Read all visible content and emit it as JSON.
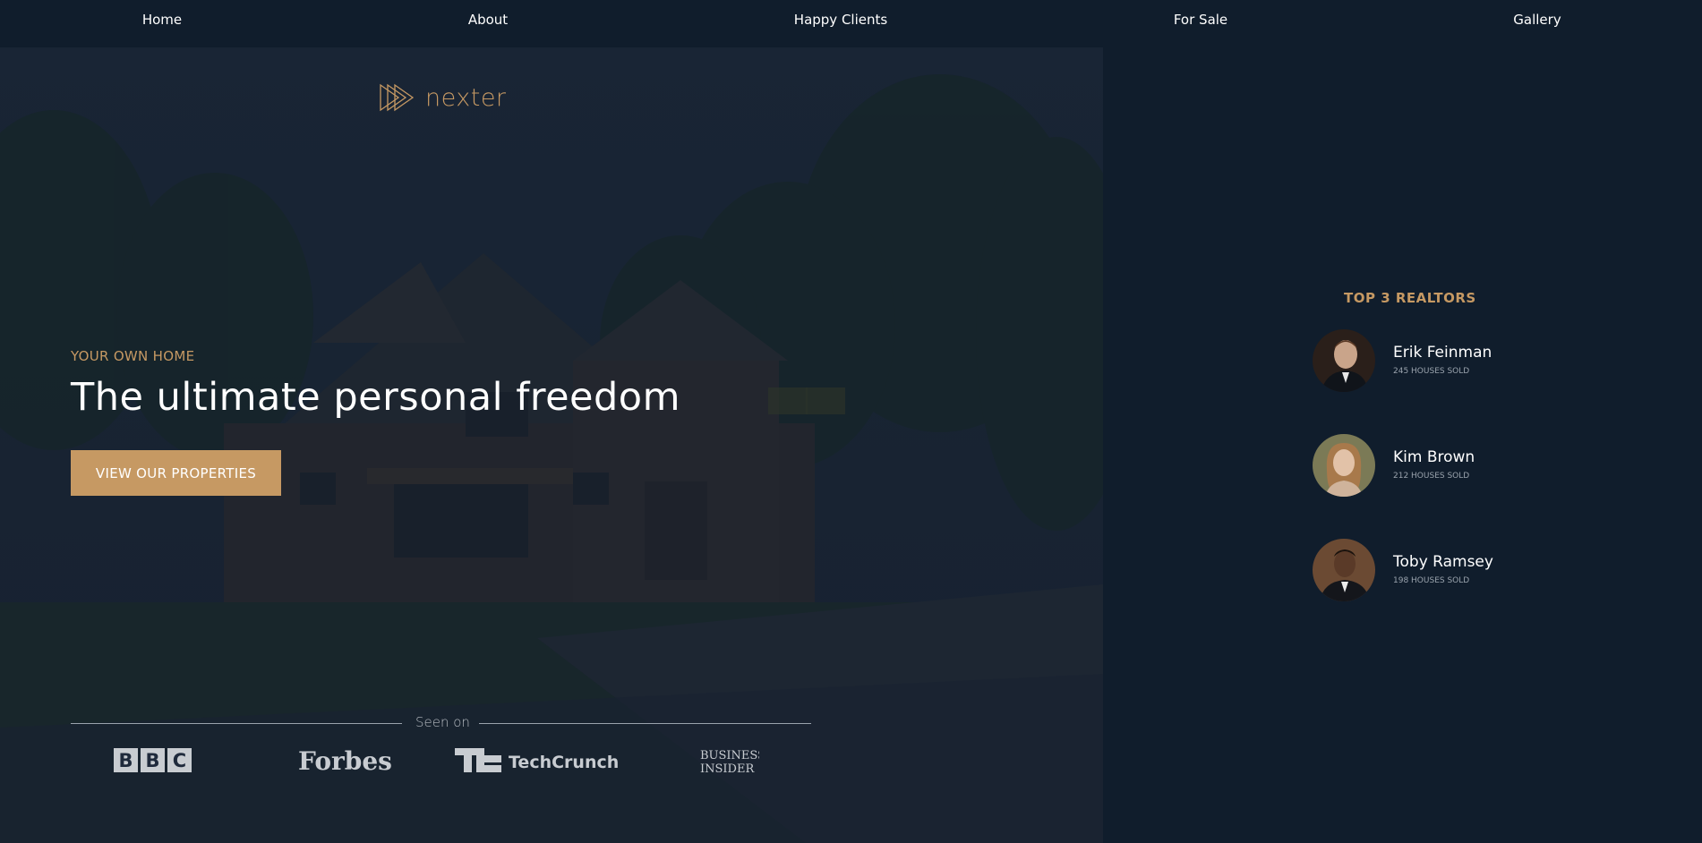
{
  "nav": {
    "items": [
      {
        "label": "Home"
      },
      {
        "label": "About"
      },
      {
        "label": "Happy Clients"
      },
      {
        "label": "For Sale"
      },
      {
        "label": "Gallery"
      }
    ]
  },
  "brand": {
    "name": "nexter",
    "accent_color": "#c69963",
    "background_color": "#101d2c"
  },
  "hero": {
    "eyebrow": "YOUR OWN HOME",
    "headline": "The ultimate personal freedom",
    "cta_label": "VIEW OUR PROPERTIES",
    "seen_on_label": "Seen on",
    "press": [
      {
        "name": "BBC",
        "icon": "bbc-logo"
      },
      {
        "name": "Forbes",
        "icon": "forbes-logo"
      },
      {
        "name": "TechCrunch",
        "icon": "techcrunch-logo"
      },
      {
        "name": "Business Insider",
        "icon": "business-insider-logo"
      }
    ]
  },
  "realtors": {
    "title": "TOP 3 REALTORS",
    "list": [
      {
        "name": "Erik Feinman",
        "sold": "245 HOUSES SOLD"
      },
      {
        "name": "Kim Brown",
        "sold": "212 HOUSES SOLD"
      },
      {
        "name": "Toby Ramsey",
        "sold": "198 HOUSES SOLD"
      }
    ]
  }
}
